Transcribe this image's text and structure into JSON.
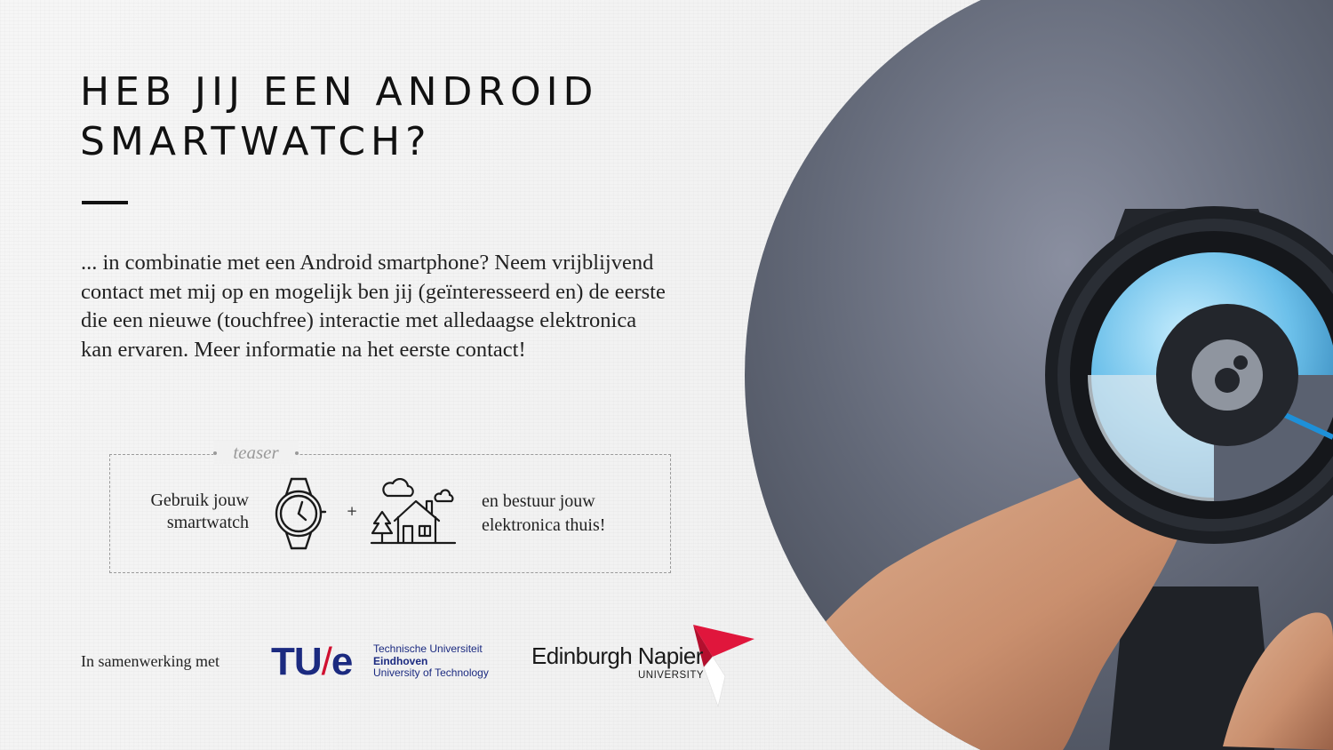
{
  "heading": {
    "title": "HEB JIJ EEN ANDROID SMARTWATCH?"
  },
  "intro": "... in combinatie met een Android smartphone? Neem vrijblijvend contact met mij op en mogelijk ben jij (geïnteresseerd en) de eerste die een nieuwe (touchfree) interactie met alledaagse elektronica kan ervaren. Meer informatie na het eerste contact!",
  "teaser": {
    "label": "teaser",
    "left_text": "Gebruik jouw smartwatch",
    "plus": "+",
    "right_text": "en bestuur jouw elektronica thuis!",
    "icons": [
      "smartwatch-icon",
      "house-icon",
      "cloud-icon",
      "tree-icon"
    ]
  },
  "partners": {
    "label": "In samenwerking met",
    "tue": {
      "mark": "TU",
      "slash": "/",
      "mark_suffix": "e",
      "line1": "Technische Universiteit",
      "line2": "Eindhoven",
      "line3": "University of Technology",
      "color": "#1b2a80",
      "accent": "#d01030"
    },
    "napier": {
      "name": "Edinburgh Napier",
      "sub": "UNIVERSITY",
      "accent": "#e0163c"
    }
  },
  "photo": {
    "subject": "hand holding a smartwatch with a blue dial",
    "background_color": "#5d6371",
    "dial_color": "#4aa8d8"
  }
}
